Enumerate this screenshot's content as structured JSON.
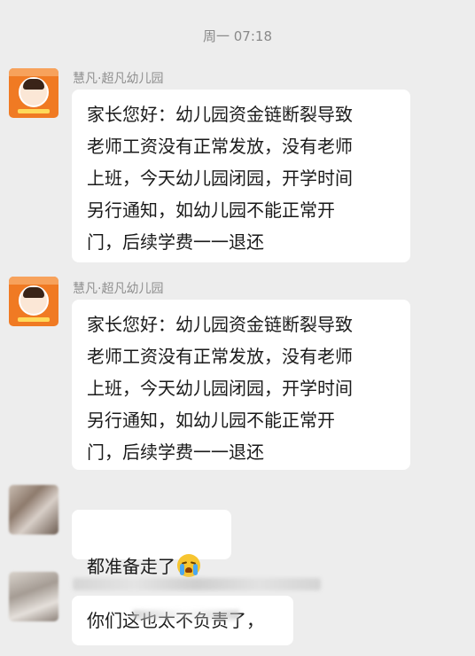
{
  "timestamp": "周一 07:18",
  "messages": [
    {
      "sender": "慧凡·超凡幼儿园",
      "text": "家长您好：幼儿园资金链断裂导致\n老师工资没有正常发放，没有老师\n上班，今天幼儿园闭园，开学时间\n另行通知，如幼儿园不能正常开\n门，后续学费一一退还"
    },
    {
      "sender": "慧凡·超凡幼儿园",
      "text": "家长您好：幼儿园资金链断裂导致\n老师工资没有正常发放，没有老师\n上班，今天幼儿园闭园，开学时间\n另行通知，如幼儿园不能正常开\n门，后续学费一一退还"
    },
    {
      "sender": "",
      "text": "都准备走了"
    },
    {
      "sender": "",
      "text": "你们这也太不负责了，"
    }
  ],
  "icons": {
    "avatar_brand": "kindergarten-avatar-icon",
    "emoji": "crying-face-icon"
  },
  "colors": {
    "background": "#ededed",
    "bubble": "#ffffff",
    "avatar_brand": "#f07a23"
  }
}
